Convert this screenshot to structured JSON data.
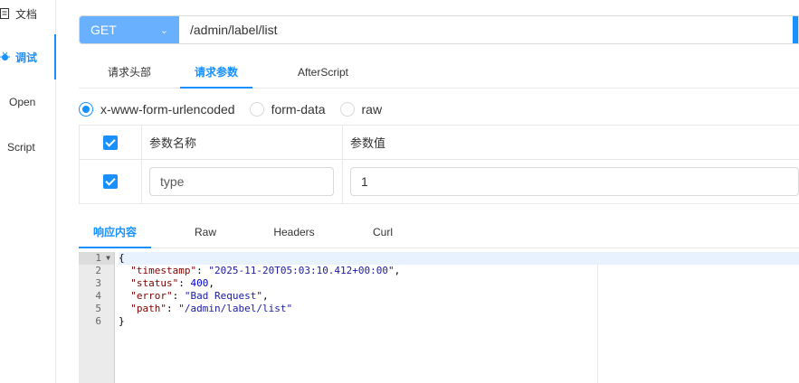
{
  "sidebar": {
    "items": [
      {
        "label": "文档",
        "icon": "document-icon"
      },
      {
        "label": "调试",
        "icon": "debug-icon",
        "active": true
      },
      {
        "label": "Open"
      },
      {
        "label": "Script"
      }
    ]
  },
  "request": {
    "method": "GET",
    "url": "/admin/label/list"
  },
  "request_tabs": [
    {
      "label": "请求头部"
    },
    {
      "label": "请求参数",
      "active": true
    },
    {
      "label": "AfterScript"
    }
  ],
  "body_types": [
    {
      "label": "x-www-form-urlencoded",
      "checked": true
    },
    {
      "label": "form-data",
      "checked": false
    },
    {
      "label": "raw",
      "checked": false
    }
  ],
  "params": {
    "headers": {
      "name": "参数名称",
      "value": "参数值"
    },
    "rows": [
      {
        "checked": true,
        "name": "type",
        "value": "1"
      }
    ]
  },
  "response_tabs": [
    {
      "label": "响应内容",
      "active": true
    },
    {
      "label": "Raw"
    },
    {
      "label": "Headers"
    },
    {
      "label": "Curl"
    }
  ],
  "response": {
    "line_numbers": [
      "1",
      "2",
      "3",
      "4",
      "5",
      "6"
    ],
    "code_lines": [
      "{",
      "  \"timestamp\": \"2025-11-20T05:03:10.412+00:00\",",
      "  \"status\": 400,",
      "  \"error\": \"Bad Request\",",
      "  \"path\": \"/admin/label/list\"",
      "}"
    ]
  },
  "colors": {
    "accent": "#1890ff",
    "method_bg": "#69b1ff"
  }
}
